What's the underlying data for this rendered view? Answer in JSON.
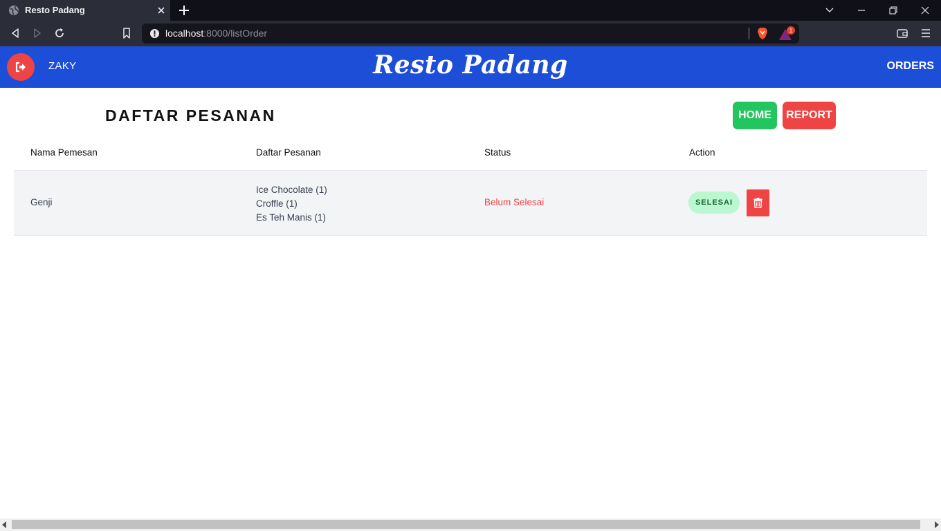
{
  "browser": {
    "tab_title": "Resto Padang",
    "url_host": "localhost",
    "url_path": ":8000/listOrder",
    "rewards_badge": "1"
  },
  "navbar": {
    "username": "ZAKY",
    "brand": "Resto Padang",
    "orders_link": "ORDERS",
    "accent_color": "#1d4ed8"
  },
  "page": {
    "title": "DAFTAR PESANAN",
    "home_button": "HOME",
    "report_button": "REPORT"
  },
  "table": {
    "headers": [
      "Nama Pemesan",
      "Daftar Pesanan",
      "Status",
      "Action"
    ],
    "rows": [
      {
        "name": "Genji",
        "items": [
          "Ice Chocolate (1)",
          "Croffle (1)",
          "Es Teh Manis (1)"
        ],
        "status": "Belum Selesai",
        "done_label": "SELESAI"
      }
    ]
  },
  "icons": {
    "logout": "logout-icon",
    "delete": "trash-icon"
  }
}
